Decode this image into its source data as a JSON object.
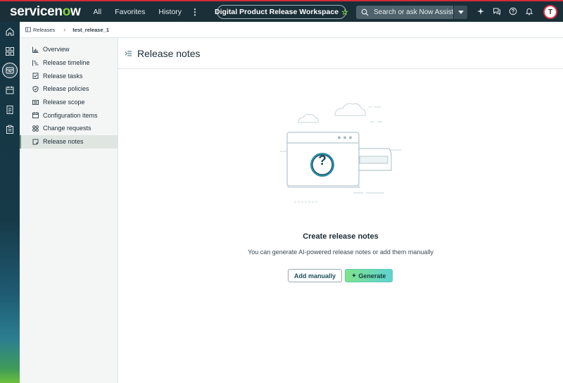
{
  "app": {
    "logo_text": "servicenow",
    "workspace_title": "Digital Product Release Workspace",
    "avatar_initial": "T"
  },
  "topnav": {
    "items": [
      {
        "label": "All"
      },
      {
        "label": "Favorites"
      },
      {
        "label": "History"
      }
    ],
    "more_label": "⋮"
  },
  "search": {
    "placeholder": "Search or ask Now Assist"
  },
  "top_icons": [
    "sparkle-icon",
    "chat-icon",
    "help-icon",
    "bell-icon"
  ],
  "rail": {
    "icons": [
      "home-icon",
      "grid-icon",
      "release-icon",
      "calendar-icon",
      "document-icon",
      "clipboard-icon"
    ],
    "active": "release-icon"
  },
  "breadcrumb": {
    "items": [
      {
        "label": "Releases"
      },
      {
        "label": "test_release_1"
      }
    ]
  },
  "sidenav": {
    "items": [
      {
        "label": "Overview",
        "icon": "chart-icon"
      },
      {
        "label": "Release timeline",
        "icon": "timeline-icon"
      },
      {
        "label": "Release tasks",
        "icon": "task-icon"
      },
      {
        "label": "Release policies",
        "icon": "shield-icon"
      },
      {
        "label": "Release scope",
        "icon": "scope-icon"
      },
      {
        "label": "Configuration items",
        "icon": "calendar-icon"
      },
      {
        "label": "Change requests",
        "icon": "change-icon"
      },
      {
        "label": "Release notes",
        "icon": "note-icon"
      }
    ],
    "active_index": 7
  },
  "main": {
    "title": "Release notes",
    "empty_state": {
      "title": "Create release notes",
      "description": "You can generate AI-powered release notes or add them manually",
      "add_manually_label": "Add manually",
      "generate_label": "Generate",
      "illustration_symbol": "?"
    }
  },
  "colors": {
    "topbar": "#1a2f38",
    "accent_red": "#d22a3a",
    "brand_green": "#7fd13b",
    "generate_gradient_start": "#7ee38a",
    "generate_gradient_end": "#5fd2d0"
  }
}
